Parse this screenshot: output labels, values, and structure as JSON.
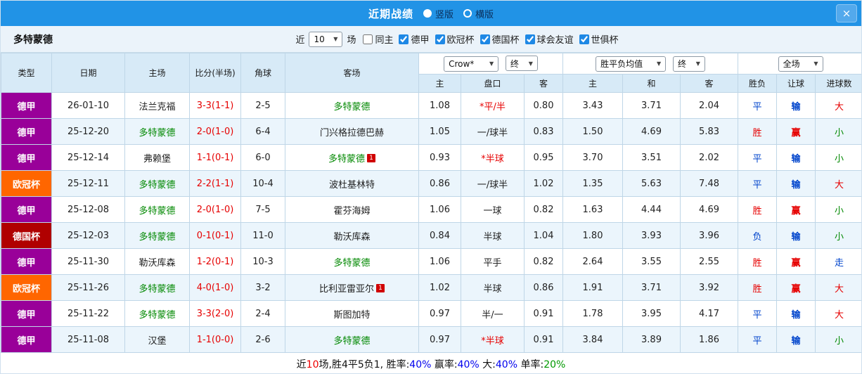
{
  "topbar": {
    "title": "近期战绩",
    "layout_options": [
      {
        "label": "竖版",
        "selected": true
      },
      {
        "label": "横版",
        "selected": false
      }
    ]
  },
  "filterbar": {
    "team": "多特蒙德",
    "near_label": "近",
    "match_count": "10",
    "games_label": "场",
    "checkboxes": [
      {
        "label": "同主",
        "checked": false
      },
      {
        "label": "德甲",
        "checked": true
      },
      {
        "label": "欧冠杯",
        "checked": true
      },
      {
        "label": "德国杯",
        "checked": true
      },
      {
        "label": "球会友谊",
        "checked": true
      },
      {
        "label": "世俱杯",
        "checked": true
      }
    ]
  },
  "table": {
    "col_headers": {
      "type": "类型",
      "date": "日期",
      "home": "主场",
      "score": "比分(半场)",
      "corner": "角球",
      "away": "客场",
      "odds_home": "主",
      "handicap": "盘口",
      "odds_away": "客",
      "avg_home": "主",
      "avg_draw": "和",
      "avg_away": "客",
      "result": "胜负",
      "let_ball": "让球",
      "goals": "进球数"
    },
    "selects": {
      "company": "Crow*",
      "company_time": "终",
      "avg": "胜平负均值",
      "avg_time": "终",
      "scope": "全场"
    },
    "rows": [
      {
        "league": {
          "t": "德甲",
          "c": "lg-de"
        },
        "date": {
          "t": "26-01-10",
          "c": ""
        },
        "home": {
          "t": "法兰克福",
          "c": ""
        },
        "score": {
          "t": "3-3(1-1)",
          "c": "red"
        },
        "corner": {
          "t": "2-5",
          "c": ""
        },
        "away": {
          "t": "多特蒙德",
          "c": "green"
        },
        "away_badge": "",
        "odds_home": {
          "t": "1.08",
          "c": ""
        },
        "handicap": {
          "t": "*平/半",
          "c": "red"
        },
        "odds_away": {
          "t": "0.80",
          "c": ""
        },
        "avg_home": {
          "t": "3.43",
          "c": ""
        },
        "avg_draw": {
          "t": "3.71",
          "c": ""
        },
        "avg_away": {
          "t": "2.04",
          "c": ""
        },
        "result": {
          "t": "平",
          "c": "blue"
        },
        "let_ball": {
          "t": "输",
          "c": "blue bold"
        },
        "goals": {
          "t": "大",
          "c": "red"
        }
      },
      {
        "league": {
          "t": "德甲",
          "c": "lg-de"
        },
        "date": {
          "t": "25-12-20",
          "c": ""
        },
        "home": {
          "t": "多特蒙德",
          "c": "green"
        },
        "score": {
          "t": "2-0(1-0)",
          "c": "red"
        },
        "corner": {
          "t": "6-4",
          "c": ""
        },
        "away": {
          "t": "门兴格拉德巴赫",
          "c": ""
        },
        "away_badge": "",
        "odds_home": {
          "t": "1.05",
          "c": ""
        },
        "handicap": {
          "t": "一/球半",
          "c": ""
        },
        "odds_away": {
          "t": "0.83",
          "c": ""
        },
        "avg_home": {
          "t": "1.50",
          "c": ""
        },
        "avg_draw": {
          "t": "4.69",
          "c": ""
        },
        "avg_away": {
          "t": "5.83",
          "c": ""
        },
        "result": {
          "t": "胜",
          "c": "red"
        },
        "let_ball": {
          "t": "赢",
          "c": "red bold"
        },
        "goals": {
          "t": "小",
          "c": "green"
        }
      },
      {
        "league": {
          "t": "德甲",
          "c": "lg-de"
        },
        "date": {
          "t": "25-12-14",
          "c": ""
        },
        "home": {
          "t": "弗赖堡",
          "c": ""
        },
        "score": {
          "t": "1-1(0-1)",
          "c": "red"
        },
        "corner": {
          "t": "6-0",
          "c": ""
        },
        "away": {
          "t": "多特蒙德",
          "c": "green"
        },
        "away_badge": "1",
        "odds_home": {
          "t": "0.93",
          "c": ""
        },
        "handicap": {
          "t": "*半球",
          "c": "red"
        },
        "odds_away": {
          "t": "0.95",
          "c": ""
        },
        "avg_home": {
          "t": "3.70",
          "c": ""
        },
        "avg_draw": {
          "t": "3.51",
          "c": ""
        },
        "avg_away": {
          "t": "2.02",
          "c": ""
        },
        "result": {
          "t": "平",
          "c": "blue"
        },
        "let_ball": {
          "t": "输",
          "c": "blue bold"
        },
        "goals": {
          "t": "小",
          "c": "green"
        }
      },
      {
        "league": {
          "t": "欧冠杯",
          "c": "lg-cl"
        },
        "date": {
          "t": "25-12-11",
          "c": ""
        },
        "home": {
          "t": "多特蒙德",
          "c": "green"
        },
        "score": {
          "t": "2-2(1-1)",
          "c": "red"
        },
        "corner": {
          "t": "10-4",
          "c": ""
        },
        "away": {
          "t": "波杜基林特",
          "c": ""
        },
        "away_badge": "",
        "odds_home": {
          "t": "0.86",
          "c": ""
        },
        "handicap": {
          "t": "一/球半",
          "c": ""
        },
        "odds_away": {
          "t": "1.02",
          "c": ""
        },
        "avg_home": {
          "t": "1.35",
          "c": ""
        },
        "avg_draw": {
          "t": "5.63",
          "c": ""
        },
        "avg_away": {
          "t": "7.48",
          "c": ""
        },
        "result": {
          "t": "平",
          "c": "blue"
        },
        "let_ball": {
          "t": "输",
          "c": "blue bold"
        },
        "goals": {
          "t": "大",
          "c": "red"
        }
      },
      {
        "league": {
          "t": "德甲",
          "c": "lg-de"
        },
        "date": {
          "t": "25-12-08",
          "c": ""
        },
        "home": {
          "t": "多特蒙德",
          "c": "green"
        },
        "score": {
          "t": "2-0(1-0)",
          "c": "red"
        },
        "corner": {
          "t": "7-5",
          "c": ""
        },
        "away": {
          "t": "霍芬海姆",
          "c": ""
        },
        "away_badge": "",
        "odds_home": {
          "t": "1.06",
          "c": ""
        },
        "handicap": {
          "t": "一球",
          "c": ""
        },
        "odds_away": {
          "t": "0.82",
          "c": ""
        },
        "avg_home": {
          "t": "1.63",
          "c": ""
        },
        "avg_draw": {
          "t": "4.44",
          "c": ""
        },
        "avg_away": {
          "t": "4.69",
          "c": ""
        },
        "result": {
          "t": "胜",
          "c": "red"
        },
        "let_ball": {
          "t": "赢",
          "c": "red bold"
        },
        "goals": {
          "t": "小",
          "c": "green"
        }
      },
      {
        "league": {
          "t": "德国杯",
          "c": "lg-cup"
        },
        "date": {
          "t": "25-12-03",
          "c": ""
        },
        "home": {
          "t": "多特蒙德",
          "c": "green"
        },
        "score": {
          "t": "0-1(0-1)",
          "c": "red"
        },
        "corner": {
          "t": "11-0",
          "c": ""
        },
        "away": {
          "t": "勒沃库森",
          "c": ""
        },
        "away_badge": "",
        "odds_home": {
          "t": "0.84",
          "c": ""
        },
        "handicap": {
          "t": "半球",
          "c": ""
        },
        "odds_away": {
          "t": "1.04",
          "c": ""
        },
        "avg_home": {
          "t": "1.80",
          "c": ""
        },
        "avg_draw": {
          "t": "3.93",
          "c": ""
        },
        "avg_away": {
          "t": "3.96",
          "c": ""
        },
        "result": {
          "t": "负",
          "c": "blue"
        },
        "let_ball": {
          "t": "输",
          "c": "blue bold"
        },
        "goals": {
          "t": "小",
          "c": "green"
        }
      },
      {
        "league": {
          "t": "德甲",
          "c": "lg-de"
        },
        "date": {
          "t": "25-11-30",
          "c": ""
        },
        "home": {
          "t": "勒沃库森",
          "c": ""
        },
        "score": {
          "t": "1-2(0-1)",
          "c": "red"
        },
        "corner": {
          "t": "10-3",
          "c": ""
        },
        "away": {
          "t": "多特蒙德",
          "c": "green"
        },
        "away_badge": "",
        "odds_home": {
          "t": "1.06",
          "c": ""
        },
        "handicap": {
          "t": "平手",
          "c": ""
        },
        "odds_away": {
          "t": "0.82",
          "c": ""
        },
        "avg_home": {
          "t": "2.64",
          "c": ""
        },
        "avg_draw": {
          "t": "3.55",
          "c": ""
        },
        "avg_away": {
          "t": "2.55",
          "c": ""
        },
        "result": {
          "t": "胜",
          "c": "red"
        },
        "let_ball": {
          "t": "赢",
          "c": "red bold"
        },
        "goals": {
          "t": "走",
          "c": "blue"
        }
      },
      {
        "league": {
          "t": "欧冠杯",
          "c": "lg-cl"
        },
        "date": {
          "t": "25-11-26",
          "c": ""
        },
        "home": {
          "t": "多特蒙德",
          "c": "green"
        },
        "score": {
          "t": "4-0(1-0)",
          "c": "red"
        },
        "corner": {
          "t": "3-2",
          "c": ""
        },
        "away": {
          "t": "比利亚雷亚尔",
          "c": ""
        },
        "away_badge": "1",
        "odds_home": {
          "t": "1.02",
          "c": ""
        },
        "handicap": {
          "t": "半球",
          "c": ""
        },
        "odds_away": {
          "t": "0.86",
          "c": ""
        },
        "avg_home": {
          "t": "1.91",
          "c": ""
        },
        "avg_draw": {
          "t": "3.71",
          "c": ""
        },
        "avg_away": {
          "t": "3.92",
          "c": ""
        },
        "result": {
          "t": "胜",
          "c": "red"
        },
        "let_ball": {
          "t": "赢",
          "c": "red bold"
        },
        "goals": {
          "t": "大",
          "c": "red"
        }
      },
      {
        "league": {
          "t": "德甲",
          "c": "lg-de"
        },
        "date": {
          "t": "25-11-22",
          "c": ""
        },
        "home": {
          "t": "多特蒙德",
          "c": "green"
        },
        "score": {
          "t": "3-3(2-0)",
          "c": "red"
        },
        "corner": {
          "t": "2-4",
          "c": ""
        },
        "away": {
          "t": "斯图加特",
          "c": ""
        },
        "away_badge": "",
        "odds_home": {
          "t": "0.97",
          "c": ""
        },
        "handicap": {
          "t": "半/一",
          "c": ""
        },
        "odds_away": {
          "t": "0.91",
          "c": ""
        },
        "avg_home": {
          "t": "1.78",
          "c": ""
        },
        "avg_draw": {
          "t": "3.95",
          "c": ""
        },
        "avg_away": {
          "t": "4.17",
          "c": ""
        },
        "result": {
          "t": "平",
          "c": "blue"
        },
        "let_ball": {
          "t": "输",
          "c": "blue bold"
        },
        "goals": {
          "t": "大",
          "c": "red"
        }
      },
      {
        "league": {
          "t": "德甲",
          "c": "lg-de"
        },
        "date": {
          "t": "25-11-08",
          "c": ""
        },
        "home": {
          "t": "汉堡",
          "c": ""
        },
        "score": {
          "t": "1-1(0-0)",
          "c": "red"
        },
        "corner": {
          "t": "2-6",
          "c": ""
        },
        "away": {
          "t": "多特蒙德",
          "c": "green"
        },
        "away_badge": "",
        "odds_home": {
          "t": "0.97",
          "c": ""
        },
        "handicap": {
          "t": "*半球",
          "c": "red"
        },
        "odds_away": {
          "t": "0.91",
          "c": ""
        },
        "avg_home": {
          "t": "3.84",
          "c": ""
        },
        "avg_draw": {
          "t": "3.89",
          "c": ""
        },
        "avg_away": {
          "t": "1.86",
          "c": ""
        },
        "result": {
          "t": "平",
          "c": "blue"
        },
        "let_ball": {
          "t": "输",
          "c": "blue bold"
        },
        "goals": {
          "t": "小",
          "c": "green"
        }
      }
    ]
  },
  "footer": {
    "segments": [
      {
        "t": "近",
        "c": ""
      },
      {
        "t": "10",
        "c": "red"
      },
      {
        "t": "场,胜4平5负1, 胜率:",
        "c": ""
      },
      {
        "t": "40%",
        "c": "blue"
      },
      {
        "t": " 赢率:",
        "c": ""
      },
      {
        "t": "40%",
        "c": "blue"
      },
      {
        "t": " 大:",
        "c": ""
      },
      {
        "t": "40%",
        "c": "blue"
      },
      {
        "t": " 单率:",
        "c": ""
      },
      {
        "t": "20%",
        "c": "green"
      }
    ]
  },
  "colors": {
    "topbar_blue": "#2193e6",
    "league_dejia": "#990099",
    "league_ouguan": "#ff6600",
    "league_deguobei": "#b00000",
    "team_green": "#008800",
    "score_red": "#e60000",
    "text_blue": "#0044cc",
    "header_bg": "#d7eaf7",
    "zebra_bg": "#ebf5fc"
  }
}
